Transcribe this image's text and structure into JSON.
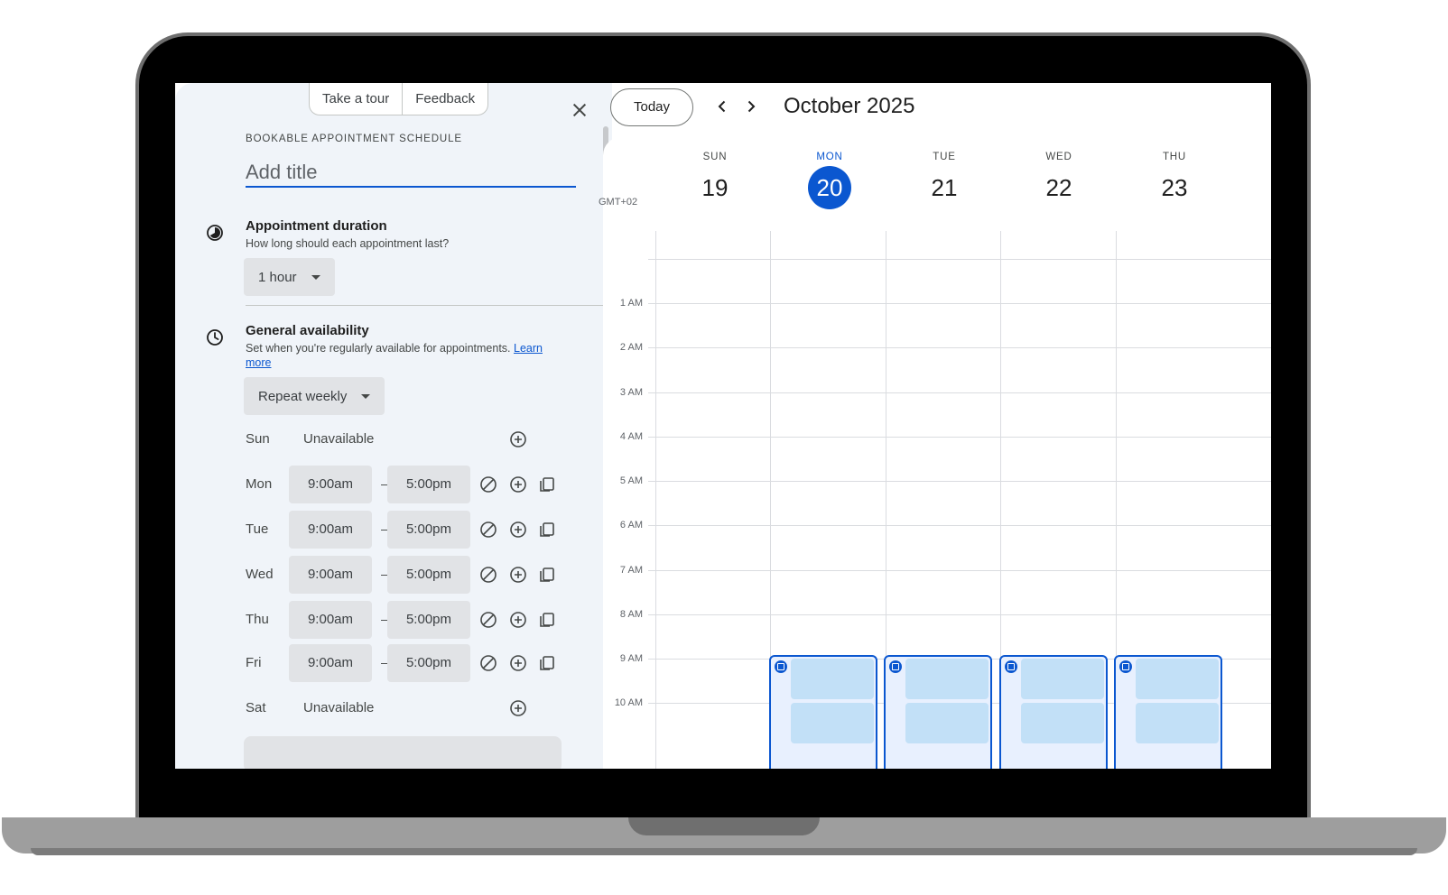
{
  "panel": {
    "take_tour": "Take a tour",
    "feedback": "Feedback",
    "overline": "BOOKABLE APPOINTMENT SCHEDULE",
    "title_placeholder": "Add title",
    "duration": {
      "title": "Appointment duration",
      "subtitle": "How long should each appointment last?",
      "value": "1 hour",
      "icon": "duration-icon"
    },
    "availability": {
      "title": "General availability",
      "subtitle": "Set when you're regularly available for appointments.",
      "learn_more": "Learn more",
      "repeat": "Repeat weekly",
      "icon": "clock-icon"
    },
    "days": [
      {
        "label": "Sun",
        "status": "Unavailable"
      },
      {
        "label": "Mon",
        "start": "9:00am",
        "end": "5:00pm"
      },
      {
        "label": "Tue",
        "start": "9:00am",
        "end": "5:00pm"
      },
      {
        "label": "Wed",
        "start": "9:00am",
        "end": "5:00pm"
      },
      {
        "label": "Thu",
        "start": "9:00am",
        "end": "5:00pm"
      },
      {
        "label": "Fri",
        "start": "9:00am",
        "end": "5:00pm"
      },
      {
        "label": "Sat",
        "status": "Unavailable"
      }
    ],
    "dash": "–"
  },
  "calendar": {
    "today_label": "Today",
    "month_label": "October 2025",
    "timezone": "GMT+02",
    "days": [
      {
        "name": "SUN",
        "date": "19"
      },
      {
        "name": "MON",
        "date": "20",
        "active": true
      },
      {
        "name": "TUE",
        "date": "21"
      },
      {
        "name": "WED",
        "date": "22"
      },
      {
        "name": "THU",
        "date": "23"
      }
    ],
    "hours": [
      "1 AM",
      "2 AM",
      "3 AM",
      "4 AM",
      "5 AM",
      "6 AM",
      "7 AM",
      "8 AM",
      "9 AM",
      "10 AM"
    ],
    "accent_color": "#0b57d0",
    "slot_color": "#c2e0f7"
  }
}
